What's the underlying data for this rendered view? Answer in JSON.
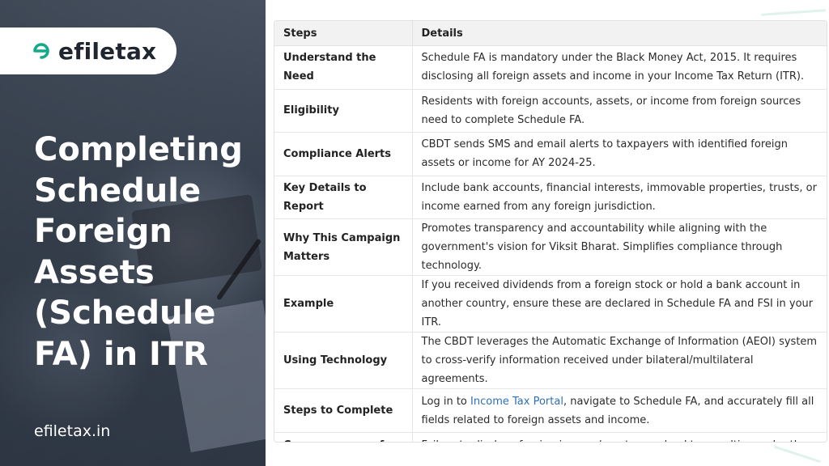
{
  "brand": {
    "logo_text": "efiletax",
    "site_url": "efiletax.in",
    "accent_color": "#14a98a"
  },
  "hero": {
    "title_lines": [
      "Completing",
      "Schedule",
      "Foreign",
      "Assets",
      "(Schedule",
      "FA) in ITR"
    ]
  },
  "table": {
    "headers": [
      "Steps",
      "Details"
    ],
    "rows": [
      {
        "step": "Understand the Need",
        "detail": "Schedule FA is mandatory under the Black Money Act, 2015. It requires disclosing all foreign assets and income in your Income Tax Return (ITR)."
      },
      {
        "step": "Eligibility",
        "detail": "Residents with foreign accounts, assets, or income from foreign sources need to complete Schedule FA."
      },
      {
        "step": "Compliance Alerts",
        "detail": "CBDT sends SMS and email alerts to taxpayers with identified foreign assets or income for AY 2024-25."
      },
      {
        "step": "Key Details to Report",
        "detail": "Include bank accounts, financial interests, immovable properties, trusts, or income earned from any foreign jurisdiction."
      },
      {
        "step": "Why This Campaign Matters",
        "detail": "Promotes transparency and accountability while aligning with the government's vision for Viksit Bharat. Simplifies compliance through technology."
      },
      {
        "step": "Example",
        "detail": "If you received dividends from a foreign stock or hold a bank account in another country, ensure these are declared in Schedule FA and FSI in your ITR."
      },
      {
        "step": "Using Technology",
        "detail": "The CBDT leverages the Automatic Exchange of Information (AEOI) system to cross-verify information received under bilateral/multilateral agreements."
      },
      {
        "step": "Steps to Complete",
        "detail_before": "Log in to ",
        "detail_link": "Income Tax Portal",
        "detail_after": ", navigate to Schedule FA, and accurately fill all fields related to foreign assets and income."
      },
      {
        "step": "Consequences of Non-Compliance",
        "detail": "Failure to disclose foreign income/assets may lead to penalties under the Black Money Act."
      }
    ]
  }
}
